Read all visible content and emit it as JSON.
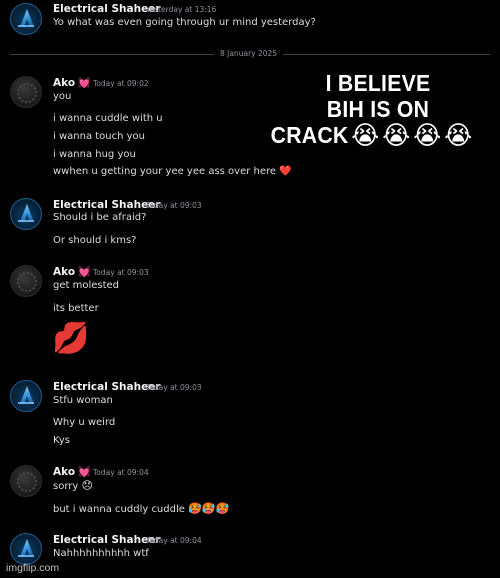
{
  "header_msg": {
    "author": "Electrical Shaheer",
    "timestamp": "Yesterday at 13:16",
    "text": "Yo what was even going through ur mind yesterday?"
  },
  "date_separator": "8 January 2025",
  "groups": [
    {
      "author": "Ako",
      "badge": "💓",
      "timestamp": "Today at 09:02",
      "lines": [
        "you",
        "i wanna cuddle with u",
        "i wanna touch you",
        "i wanna hug you",
        "wwhen u getting your yee yee ass over here"
      ],
      "trailing_emoji": "❤️"
    },
    {
      "author": "Electrical Shaheer",
      "timestamp": "Today at 09:03",
      "lines": [
        "Should i be afraid?",
        "Or should i kms?"
      ]
    },
    {
      "author": "Ako",
      "badge": "💓",
      "timestamp": "Today at 09:03",
      "lines": [
        "get molested",
        "its better"
      ],
      "big_emoji": "💋"
    },
    {
      "author": "Electrical Shaheer",
      "timestamp": "Today at 09:03",
      "lines": [
        "Stfu woman",
        "Why u weird",
        "Kys"
      ]
    },
    {
      "author": "Ako",
      "badge": "💓",
      "timestamp": "Today at 09:04",
      "lines": [
        "sorry",
        "but i wanna cuddly cuddle"
      ],
      "sorry_emoji": "😞",
      "cuddle_emojis": "🥵🥵🥵"
    },
    {
      "author": "Electrical Shaheer",
      "timestamp": "Today at 09:04",
      "lines": [
        "Nahhhhhhhhhh wtf"
      ]
    }
  ],
  "overlay": {
    "line1": "I BELIEVE",
    "line2": "BIH IS ON",
    "line3": "CRACK",
    "emojis": [
      "😭",
      "😭",
      "😭",
      "😭"
    ]
  },
  "watermark": "imgflip.com"
}
